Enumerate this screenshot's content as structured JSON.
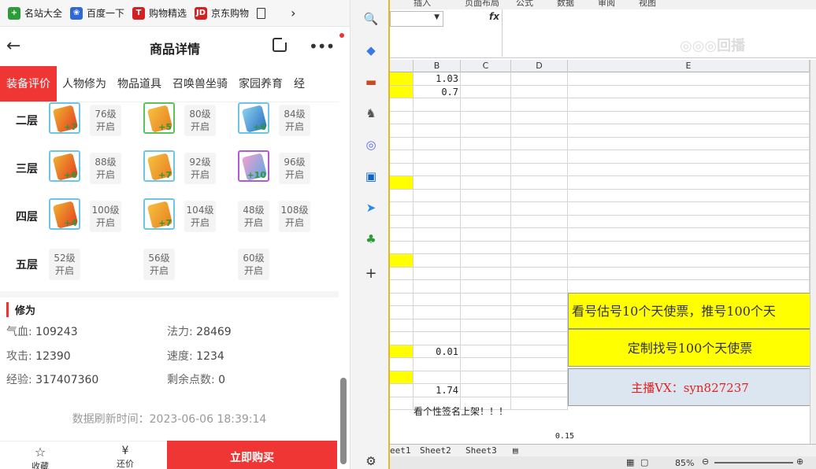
{
  "bookmarks": [
    {
      "label": "名站大全",
      "color": "#2c9b3a"
    },
    {
      "label": "百度一下",
      "color": "#2e68d8"
    },
    {
      "label": "购物精选",
      "color": "#d42020"
    },
    {
      "label": "京东购物",
      "color": "#d42020"
    }
  ],
  "header": {
    "title": "商品详情"
  },
  "tabs": [
    "装备评价",
    "人物修为",
    "物品道具",
    "召唤兽坐骑",
    "家园养育",
    "经"
  ],
  "floors": [
    {
      "label": "二层",
      "items": [
        {
          "gem": "+7",
          "level": "76级",
          "status": "开启"
        },
        {
          "gem": "+5",
          "level": "80级",
          "status": "开启"
        },
        {
          "gem": "+6",
          "level": "84级",
          "status": "开启"
        }
      ]
    },
    {
      "label": "三层",
      "items": [
        {
          "gem": "+6",
          "level": "88级",
          "status": "开启"
        },
        {
          "gem": "+7",
          "level": "92级",
          "status": "开启"
        },
        {
          "gem": "+10",
          "level": "96级",
          "status": "开启"
        }
      ]
    },
    {
      "label": "四层",
      "items": [
        {
          "gem": "+4",
          "level": "100级",
          "status": "开启"
        },
        {
          "gem": "+7",
          "level": "104级",
          "status": "开启"
        },
        {
          "gem": "",
          "level": "48级",
          "status": "开启"
        },
        {
          "gem": "",
          "level": "108级",
          "status": "开启"
        }
      ]
    },
    {
      "label": "五层",
      "items": [
        {
          "gem": "",
          "level": "52级",
          "status": "开启"
        },
        {
          "gem": "",
          "level": "56级",
          "status": "开启"
        },
        {
          "gem": "",
          "level": "60级",
          "status": "开启"
        }
      ]
    }
  ],
  "xiuwei": {
    "section": "修为",
    "attrs": [
      {
        "k": "气血:",
        "v": "109243"
      },
      {
        "k": "法力:",
        "v": "28469"
      },
      {
        "k": "攻击:",
        "v": "12390"
      },
      {
        "k": "速度:",
        "v": "1234"
      },
      {
        "k": "经验:",
        "v": "317407360"
      },
      {
        "k": "剩余点数:",
        "v": "0"
      }
    ]
  },
  "refresh": "数据刷新时间：2023-06-06 18:39:14",
  "bottom": {
    "fav": "收藏",
    "offer": "还价",
    "buy": "立即购买"
  },
  "excel": {
    "menu": [
      "插入",
      "页面布局",
      "公式",
      "数据",
      "审阅",
      "视图"
    ],
    "fx": "fx",
    "watermark": "◎◎◎回播",
    "columns": [
      "B",
      "C",
      "D",
      "E"
    ],
    "values": {
      "b1": "1.03",
      "b2": "0.7",
      "b3": "0.01",
      "b4": "1.74"
    },
    "banner1": "看号估号10个天使票，推号100个天",
    "banner2": "定制找号100个天使票",
    "banner3": "主播VX：syn827237",
    "note": "看个性签名上架！！！",
    "small": "0.15",
    "sheets": [
      "eet1",
      "Sheet2",
      "Sheet3"
    ],
    "zoom": "85%"
  }
}
